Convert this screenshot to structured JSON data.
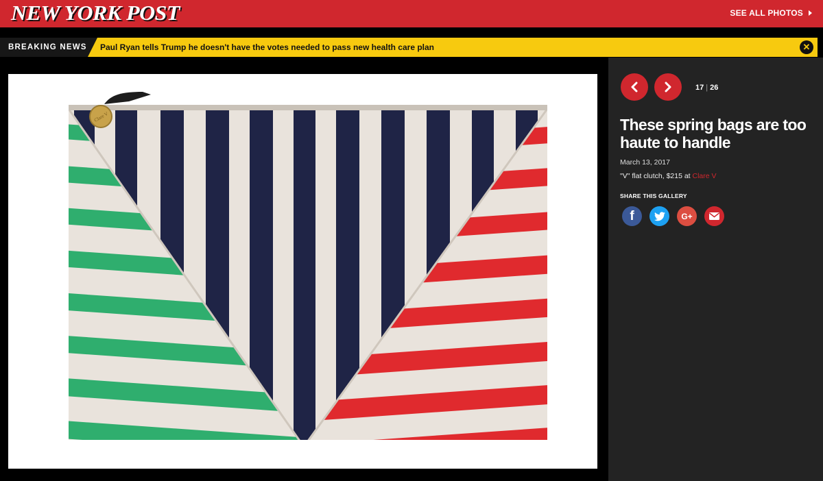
{
  "header": {
    "logo": "NEW YORK POST",
    "see_all_label": "SEE ALL PHOTOS"
  },
  "breaking": {
    "label": "BREAKING NEWS",
    "text": "Paul Ryan tells Trump he doesn't have the votes needed to pass new health care plan",
    "close_icon": "close-icon"
  },
  "gallery": {
    "current": "17",
    "total": "26",
    "prev_icon": "chevron-left-icon",
    "next_icon": "chevron-right-icon",
    "title": "These spring bags are too haute to handle",
    "date": "March 13, 2017",
    "caption_prefix": "\"V\" flat clutch, $215 at ",
    "caption_link": "Clare V",
    "share_title": "SHARE THIS GALLERY",
    "share": [
      "facebook-icon",
      "twitter-icon",
      "google-plus-icon",
      "email-icon"
    ],
    "image_zipper_pull_text": "Clare V"
  },
  "colors": {
    "brand_red": "#d0272e",
    "breaking_yellow": "#f7ca0f",
    "sidebar_bg": "#232323",
    "stripe_navy": "#1f2446",
    "stripe_green": "#2fae6e",
    "stripe_red": "#e02a2e",
    "canvas": "#e9e3dc"
  }
}
